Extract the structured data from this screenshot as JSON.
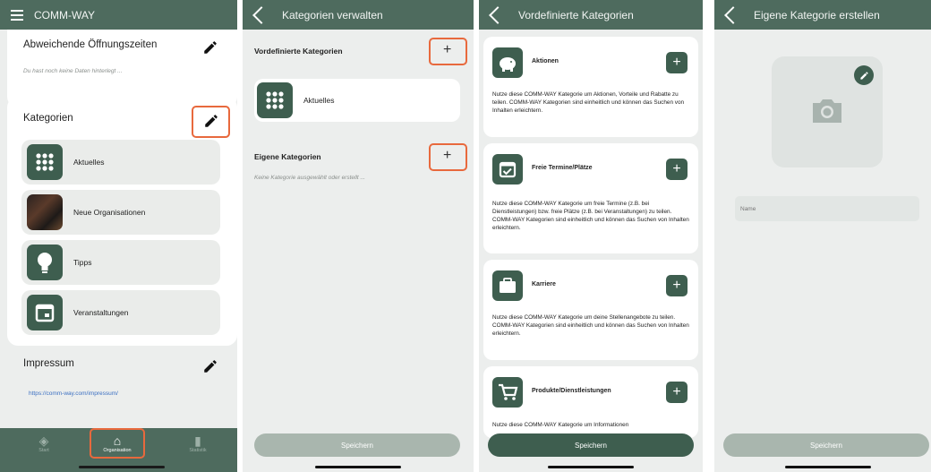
{
  "screen1": {
    "app_title": "COMM-WAY",
    "hours_title": "Abweichende Öffnungszeiten",
    "hours_empty": "Du hast noch keine Daten hinterlegt ...",
    "categories_title": "Kategorien",
    "categories": [
      {
        "label": "Aktuelles",
        "icon": "grid-icon"
      },
      {
        "label": "Neue Organisationen",
        "icon": "photo-thumbnail"
      },
      {
        "label": "Tipps",
        "icon": "lightbulb-icon"
      },
      {
        "label": "Veranstaltungen",
        "icon": "calendar-icon"
      }
    ],
    "imprint_title": "Impressum",
    "imprint_link": "https://comm-way.com/impressum/",
    "nav": [
      {
        "label": "Start",
        "icon": "layers-icon"
      },
      {
        "label": "Organisation",
        "icon": "home-icon"
      },
      {
        "label": "Statistik",
        "icon": "chart-icon"
      }
    ]
  },
  "screen2": {
    "title": "Kategorien verwalten",
    "predefined_title": "Vordefinierte Kategorien",
    "predefined_item": "Aktuelles",
    "own_title": "Eigene Kategorien",
    "own_empty": "Keine Kategorie ausgewählt oder erstellt ...",
    "save": "Speichern"
  },
  "screen3": {
    "title": "Vordefinierte Kategorien",
    "cards": [
      {
        "title": "Aktionen",
        "icon": "piggy-bank-icon",
        "desc": "Nutze diese COMM-WAY Kategorie um Aktionen, Vorteile und Rabatte zu teilen. COMM-WAY Kategorien sind einheitlich und können das Suchen von Inhalten erleichtern."
      },
      {
        "title": "Freie Termine/Plätze",
        "icon": "calendar-check-icon",
        "desc": "Nutze diese COMM-WAY Kategorie um freie Termine (z.B. bei Dienstleistungen) bzw. freie Plätze (z.B. bei Veranstaltungen) zu teilen. COMM-WAY Kategorien sind einheitlich und können das Suchen von Inhalten erleichtern."
      },
      {
        "title": "Karriere",
        "icon": "briefcase-icon",
        "desc": "Nutze diese COMM-WAY Kategorie um deine Stellenangebote zu teilen. COMM-WAY Kategorien sind einheitlich und können das Suchen von Inhalten erleichtern."
      },
      {
        "title": "Produkte/Dienstleistungen",
        "icon": "cart-icon",
        "desc": "Nutze diese COMM-WAY Kategorie um Informationen"
      }
    ],
    "save": "Speichern"
  },
  "screen4": {
    "title": "Eigene Kategorie erstellen",
    "name_placeholder": "Name",
    "save": "Speichern"
  },
  "colors": {
    "primary": "#4e6b5e",
    "icon_bg": "#3e5e4f",
    "highlight": "#e8693d",
    "save_disabled": "#a9b6ae",
    "save_active": "#3e5e4f"
  }
}
